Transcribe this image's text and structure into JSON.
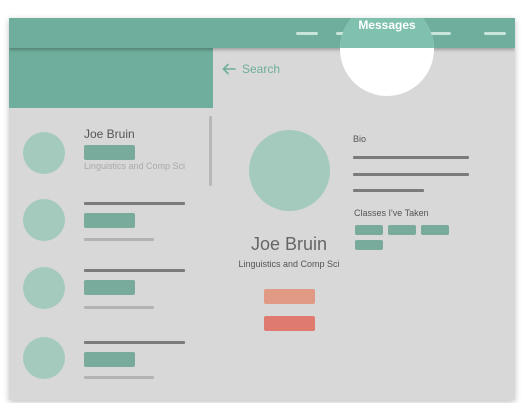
{
  "header": {
    "active_tab_label": "Messages"
  },
  "search": {
    "label": "Search",
    "icon": "arrow-left-icon"
  },
  "sidebar": {
    "items": [
      {
        "name": "Joe Bruin",
        "detail": "Linguistics and Comp Sci"
      }
    ]
  },
  "profile": {
    "name": "Joe Bruin",
    "major": "Linguistics and Comp Sci",
    "bio_label": "Bio",
    "classes_label": "Classes I've Taken"
  },
  "colors": {
    "accent": "#6fae9c",
    "avatar": "#a4cabe",
    "button_primary": "#e19a83",
    "button_secondary": "#de7b6e"
  }
}
